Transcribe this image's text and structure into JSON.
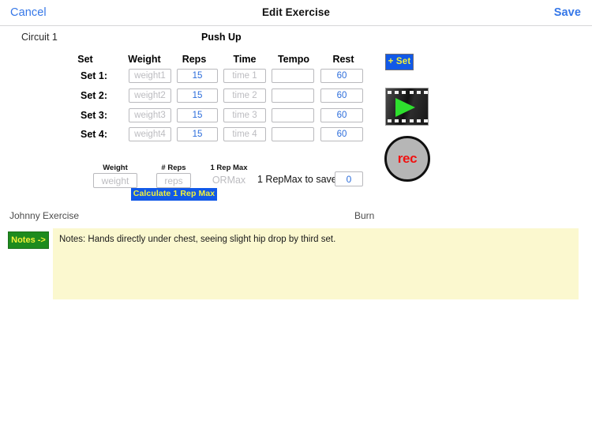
{
  "navbar": {
    "cancel_label": "Cancel",
    "title": "Edit Exercise",
    "save_label": "Save",
    "link_color": "#3577e8"
  },
  "header_row": {
    "circuit_label": "Circuit 1",
    "exercise_name": "Push Up"
  },
  "sets_table": {
    "columns": [
      "Set",
      "Weight",
      "Reps",
      "Time",
      "Tempo",
      "Rest"
    ],
    "rows": [
      {
        "label": "Set 1:",
        "weight_value": "",
        "weight_placeholder": "weight1",
        "reps_value": "15",
        "reps_placeholder": "",
        "time_value": "",
        "time_placeholder": "time 1",
        "tempo_value": "",
        "tempo_placeholder": "",
        "rest_value": "60",
        "rest_placeholder": ""
      },
      {
        "label": "Set 2:",
        "weight_value": "",
        "weight_placeholder": "weight2",
        "reps_value": "15",
        "reps_placeholder": "",
        "time_value": "",
        "time_placeholder": "time 2",
        "tempo_value": "",
        "tempo_placeholder": "",
        "rest_value": "60",
        "rest_placeholder": ""
      },
      {
        "label": "Set 3:",
        "weight_value": "",
        "weight_placeholder": "weight3",
        "reps_value": "15",
        "reps_placeholder": "",
        "time_value": "",
        "time_placeholder": "time 3",
        "tempo_value": "",
        "tempo_placeholder": "",
        "rest_value": "60",
        "rest_placeholder": ""
      },
      {
        "label": "Set 4:",
        "weight_value": "",
        "weight_placeholder": "weight4",
        "reps_value": "15",
        "reps_placeholder": "",
        "time_value": "",
        "time_placeholder": "time 4",
        "tempo_value": "",
        "tempo_placeholder": "",
        "rest_value": "60",
        "rest_placeholder": ""
      }
    ]
  },
  "side_controls": {
    "add_set_label": "+ Set",
    "add_set_bg": "#1159e8",
    "add_set_fg": "#f2f23a",
    "video_icon": "film-play-icon",
    "record_label": "rec",
    "record_fg": "#f11111",
    "record_bg": "#b6b6b6"
  },
  "rep_max": {
    "weight_label": "Weight",
    "weight_placeholder": "weight",
    "weight_value": "",
    "reps_label": "# Reps",
    "reps_placeholder": "reps",
    "reps_value": "",
    "result_label": "1 Rep Max",
    "result_value": "ORMax",
    "calculate_label": "Calculate 1 Rep Max",
    "save_label": "1 RepMax to save:",
    "save_value": "0"
  },
  "footer": {
    "user_label": "Johnny Exercise",
    "burn_label": "Burn",
    "notes_button_label": "Notes ->",
    "notes_text": "Notes: Hands directly under chest, seeing slight hip drop by third set.",
    "notes_bg": "#fbf8cf"
  }
}
